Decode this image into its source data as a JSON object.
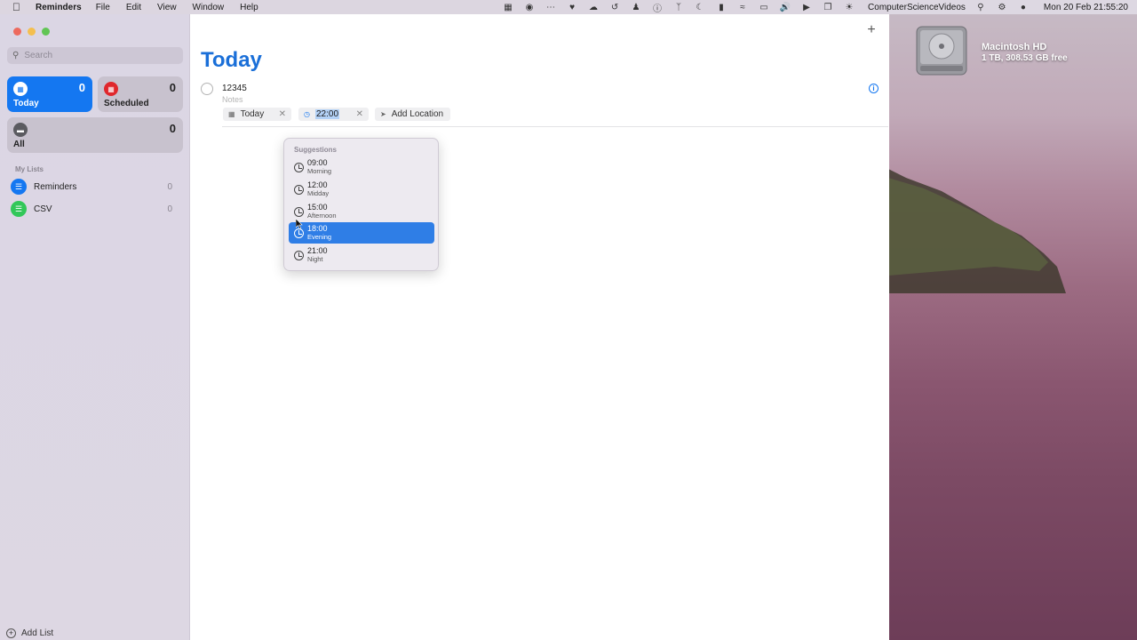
{
  "menubar": {
    "app_name": "Reminders",
    "menus": [
      "File",
      "Edit",
      "View",
      "Window",
      "Help"
    ],
    "username": "ComputerScienceVideos",
    "clock": "Mon 20 Feb  21:55:20"
  },
  "desktop": {
    "drive_name": "Macintosh HD",
    "drive_info": "1 TB, 308.53 GB free"
  },
  "sidebar": {
    "search_placeholder": "Search",
    "smart_lists": [
      {
        "label": "Today",
        "count": "0",
        "icon": "calendar-icon",
        "color": "#1477f1"
      },
      {
        "label": "Scheduled",
        "count": "0",
        "icon": "calendar-icon",
        "color": "#e0272c"
      },
      {
        "label": "All",
        "count": "0",
        "icon": "tray-icon",
        "color": "#5b5b60"
      }
    ],
    "my_lists_heading": "My Lists",
    "lists": [
      {
        "name": "Reminders",
        "count": "0",
        "color": "#1477f1",
        "icon": "list-icon"
      },
      {
        "name": "CSV",
        "count": "0",
        "color": "#32c759",
        "icon": "list-icon"
      }
    ],
    "add_list_label": "Add List"
  },
  "main": {
    "title": "Today",
    "task": {
      "title": "12345",
      "notes_placeholder": "Notes",
      "date_chip": "Today",
      "time_chip": "22:00",
      "location_chip": "Add Location"
    }
  },
  "suggestions": {
    "heading": "Suggestions",
    "options": [
      {
        "time": "09:00",
        "period": "Morning"
      },
      {
        "time": "12:00",
        "period": "Midday"
      },
      {
        "time": "15:00",
        "period": "Afternoon"
      },
      {
        "time": "18:00",
        "period": "Evening",
        "selected": true
      },
      {
        "time": "21:00",
        "period": "Night"
      }
    ]
  }
}
